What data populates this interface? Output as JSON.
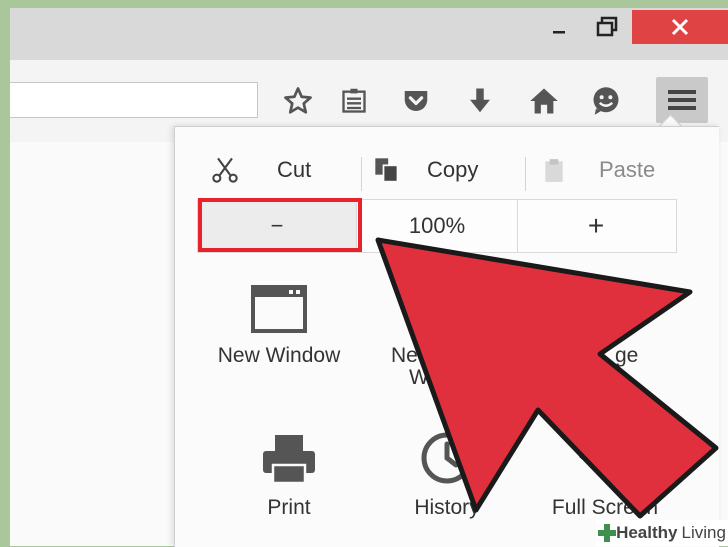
{
  "search": {
    "value": ""
  },
  "window_controls": {
    "minimize": "Minimize",
    "maximize": "Maximize",
    "close": "Close"
  },
  "toolbar": {
    "icons": [
      "star-icon",
      "reading-list-icon",
      "pocket-icon",
      "download-icon",
      "home-icon",
      "smiley-icon",
      "hamburger-menu-icon"
    ]
  },
  "menu": {
    "edit": {
      "cut": "Cut",
      "copy": "Copy",
      "paste": "Paste"
    },
    "zoom": {
      "out": "−",
      "value": "100%",
      "in": "+"
    },
    "tiles": {
      "new_window": "New Window",
      "private_window_line1": "New Pr",
      "private_window_line2": "Windo",
      "save_page": "ge",
      "print": "Print",
      "history": "History",
      "full_screen": "Full Screen"
    }
  },
  "watermark": {
    "bold": "Healthy",
    "light": "Living"
  },
  "colors": {
    "highlight": "#e8222a",
    "arrow": "#e0303e",
    "close_button": "#e04343",
    "accent_green": "#3f8f4f"
  }
}
